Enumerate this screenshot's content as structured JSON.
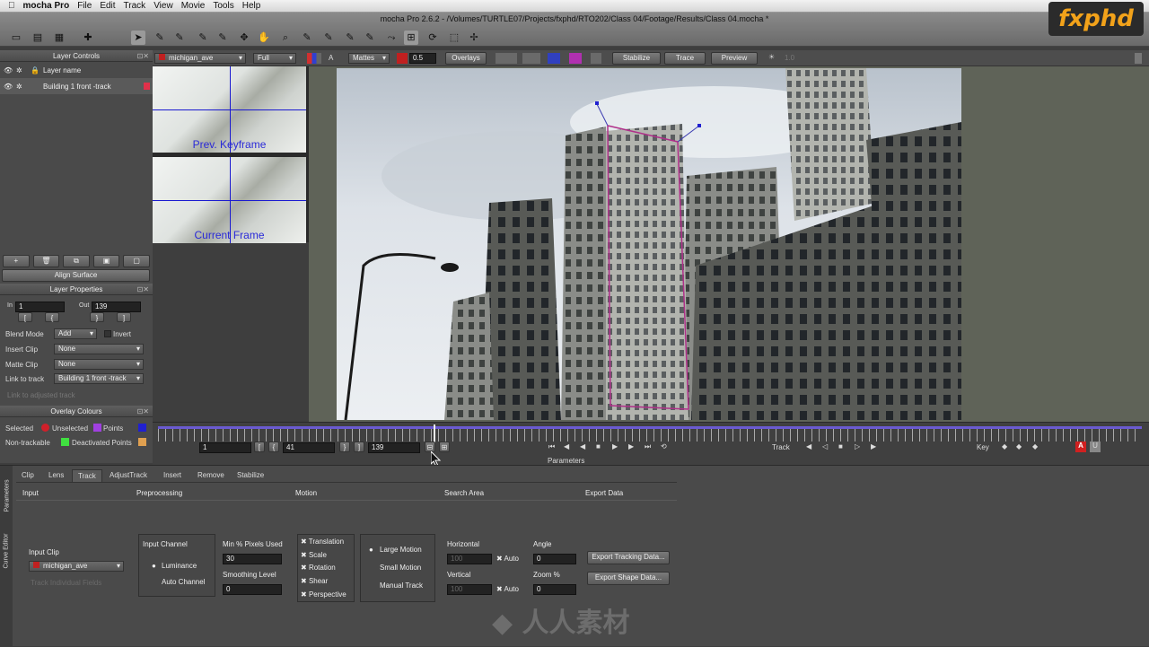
{
  "menubar": {
    "app": "mocha Pro",
    "items": [
      "File",
      "Edit",
      "Track",
      "View",
      "Movie",
      "Tools",
      "Help"
    ]
  },
  "window": {
    "title": "mocha Pro 2.6.2 - /Volumes/TURTLE07/Projects/fxphd/RTO202/Class 04/Footage/Results/Class 04.mocha *"
  },
  "logo": {
    "text": "fxphd"
  },
  "layer_controls": {
    "title": "Layer Controls",
    "header": "Layer name",
    "layers": [
      {
        "name": "Building 1 front -track",
        "color": "#e0304a"
      }
    ],
    "align_button": "Align Surface"
  },
  "layer_props": {
    "title": "Layer Properties",
    "in_label": "In",
    "in_value": "1",
    "out_label": "Out",
    "out_value": "139",
    "blend_label": "Blend Mode",
    "blend_value": "Add",
    "invert_label": "Invert",
    "insert_label": "Insert Clip",
    "insert_value": "None",
    "matte_label": "Matte Clip",
    "matte_value": "None",
    "link_label": "Link to track",
    "link_value": "Building 1 front -track",
    "link_adjusted": "Link to adjusted track"
  },
  "overlay": {
    "title": "Overlay Colours",
    "selected": "Selected",
    "unselected": "Unselected",
    "points": "Points",
    "nontrackable": "Non-trackable",
    "deactivated": "Deactivated Points",
    "colors": {
      "selected": "#d0202a",
      "unselected": "#d0202a",
      "points": "#a040e0",
      "square": "#2020d0",
      "deactivated": "#40e040",
      "orange": "#e0a050"
    }
  },
  "viewer_bar": {
    "clip": "michigan_ave",
    "res": "Full",
    "mattes": "Mattes",
    "opacity": "0.5",
    "overlays": "Overlays",
    "stabilize": "Stabilize",
    "trace": "Trace",
    "preview": "Preview",
    "value": "1.0"
  },
  "thumbs": {
    "prev": "Prev. Keyframe",
    "current": "Current Frame"
  },
  "timeline": {
    "start": "1",
    "current": "41",
    "end": "139",
    "track_label": "Track",
    "key_label": "Key",
    "params_label": "Parameters"
  },
  "params": {
    "tabs": [
      "Clip",
      "Lens",
      "Track",
      "AdjustTrack",
      "Insert",
      "Remove",
      "Stabilize"
    ],
    "active_tab": "Track",
    "side_tabs": [
      "Parameters",
      "Curve Editor"
    ],
    "sections": {
      "input": "Input",
      "preprocessing": "Preprocessing",
      "motion": "Motion",
      "search": "Search Area",
      "export": "Export Data"
    },
    "input_clip_label": "Input Clip",
    "input_clip_value": "michigan_ave",
    "track_fields": "Track Individual Fields",
    "input_channel_label": "Input Channel",
    "luminance": "Luminance",
    "auto_channel": "Auto Channel",
    "min_pixels_label": "Min % Pixels Used",
    "min_pixels_value": "30",
    "smoothing_label": "Smoothing Level",
    "smoothing_value": "0",
    "motion_opts": [
      "Translation",
      "Scale",
      "Rotation",
      "Shear",
      "Perspective"
    ],
    "motion_types": [
      "Large Motion",
      "Small Motion",
      "Manual Track"
    ],
    "horizontal": "Horizontal",
    "vertical": "Vertical",
    "horiz_value": "100",
    "vert_value": "100",
    "auto": "Auto",
    "angle": "Angle",
    "angle_value": "0",
    "zoom": "Zoom %",
    "zoom_value": "0",
    "export_tracking": "Export Tracking Data...",
    "export_shape": "Export Shape Data..."
  },
  "watermark": {
    "text": "人人素材"
  }
}
